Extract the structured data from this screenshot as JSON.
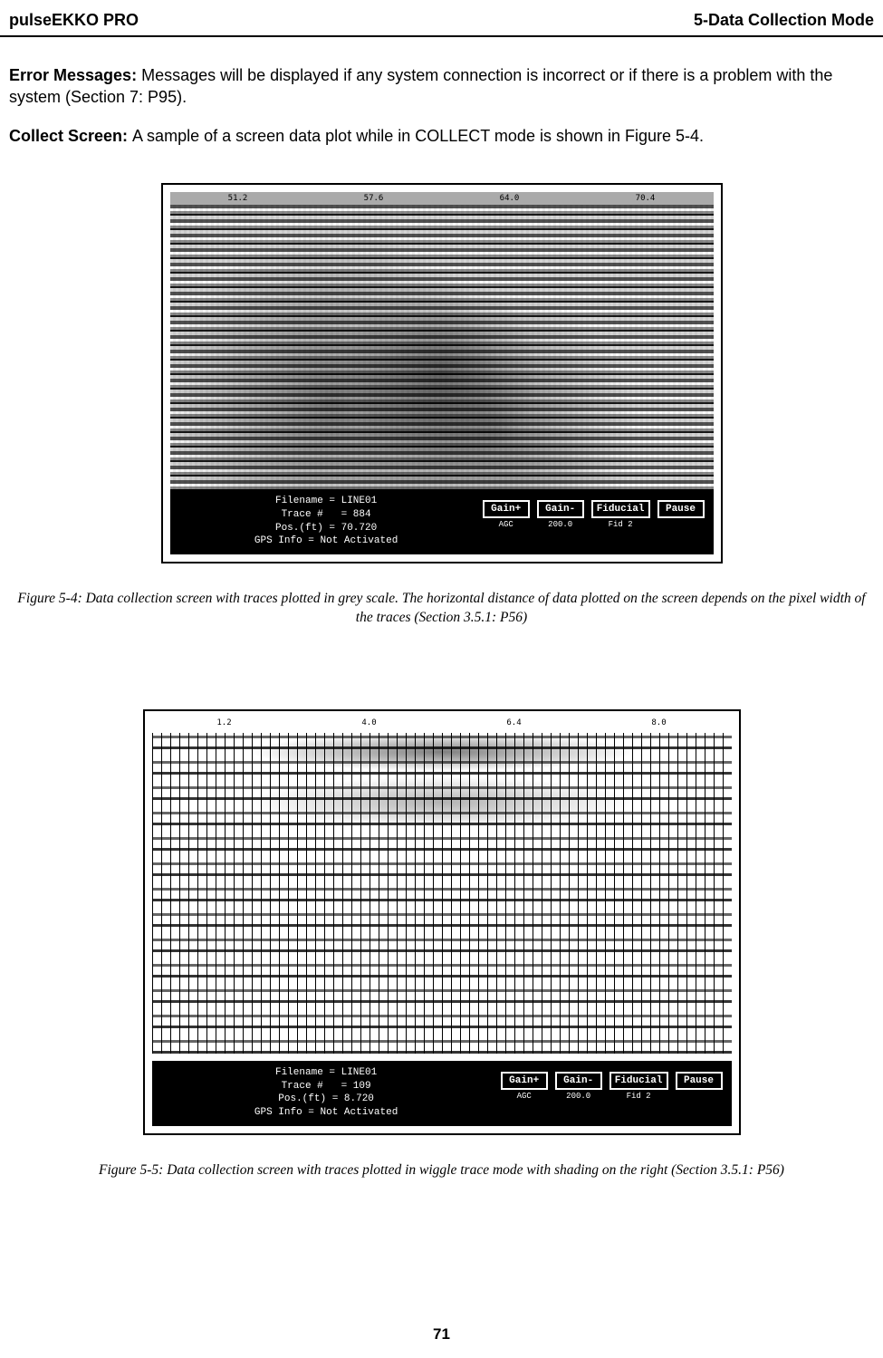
{
  "header": {
    "left": "pulseEKKO PRO",
    "right": "5-Data Collection Mode"
  },
  "para1": {
    "bold": "Error Messages: ",
    "rest": "Messages will be displayed if any system connection is incorrect or if there is a problem with the system (Section 7: P95)."
  },
  "para2": {
    "bold": "Collect Screen: ",
    "rest": "A sample of a screen data plot while in COLLECT mode is shown in Figure 5-4."
  },
  "fig54": {
    "ruler": [
      "51.2",
      "57.6",
      "64.0",
      "70.4"
    ],
    "info": "Filename = LINE01\nTrace #   = 884\nPos.(ft) = 70.720\nGPS Info = Not Activated",
    "buttons": [
      {
        "label": "Gain+",
        "sub": "AGC"
      },
      {
        "label": "Gain-",
        "sub": "200.0"
      },
      {
        "label": "Fiducial",
        "sub": "Fid 2"
      },
      {
        "label": "Pause",
        "sub": ""
      }
    ],
    "caption": " Figure 5-4:  Data collection screen with traces plotted in grey scale. The horizontal distance of data plotted on the screen depends on the pixel width of the traces (Section 3.5.1: P56)"
  },
  "fig55": {
    "ruler": [
      "1.2",
      "4.0",
      "6.4",
      "8.0"
    ],
    "info": "Filename = LINE01\nTrace #   = 109\nPos.(ft) = 8.720\nGPS Info = Not Activated",
    "buttons": [
      {
        "label": "Gain+",
        "sub": "AGC"
      },
      {
        "label": "Gain-",
        "sub": "200.0"
      },
      {
        "label": "Fiducial",
        "sub": "Fid 2"
      },
      {
        "label": "Pause",
        "sub": ""
      }
    ],
    "caption": "Figure 5-5:  Data collection screen with traces plotted in wiggle trace mode with shading on the right (Section 3.5.1: P56)"
  },
  "pageNumber": "71"
}
